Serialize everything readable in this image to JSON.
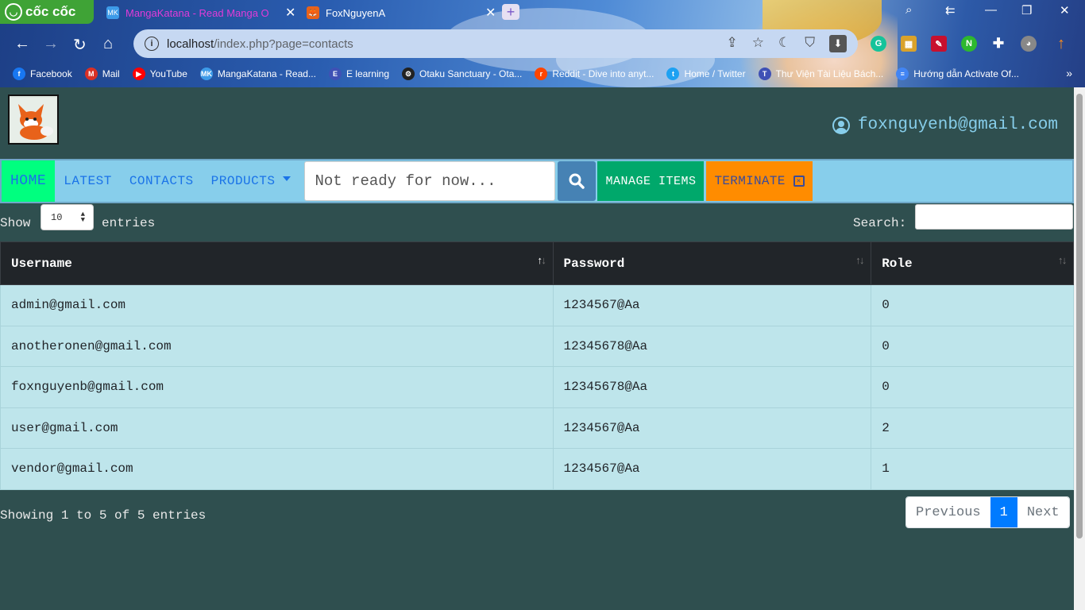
{
  "browser": {
    "brand": "cốc cốc",
    "tabs": [
      {
        "label": "MangaKatana - Read Manga O",
        "icon": "mangakatana-icon",
        "color": "#e23bd8"
      },
      {
        "label": "FoxNguyenA",
        "icon": "fox-icon",
        "color": "#ffffff"
      }
    ],
    "url_host": "localhost",
    "url_path": "/index.php?page=contacts",
    "bookmarks": [
      {
        "label": "Facebook",
        "icon": "facebook-icon",
        "color": "#1877f2",
        "glyph": "f"
      },
      {
        "label": "Mail",
        "icon": "gmail-icon",
        "color": "#d93025",
        "glyph": "M"
      },
      {
        "label": "YouTube",
        "icon": "youtube-icon",
        "color": "#ff0000",
        "glyph": "▶"
      },
      {
        "label": "MangaKatana - Read...",
        "icon": "mangakatana-icon",
        "color": "#3d9be9",
        "glyph": "MK"
      },
      {
        "label": "E learning",
        "icon": "elearning-icon",
        "color": "#3f51b5",
        "glyph": "E"
      },
      {
        "label": "Otaku Sanctuary - Ota...",
        "icon": "otaku-icon",
        "color": "#222222",
        "glyph": "⚙"
      },
      {
        "label": "Reddit - Dive into anyt...",
        "icon": "reddit-icon",
        "color": "#ff4500",
        "glyph": "r"
      },
      {
        "label": "Home / Twitter",
        "icon": "twitter-icon",
        "color": "#1da1f2",
        "glyph": "t"
      },
      {
        "label": "Thư Viện Tài Liệu Bách...",
        "icon": "library-icon",
        "color": "#3f51b5",
        "glyph": "T"
      },
      {
        "label": "Hướng dẫn Activate Of...",
        "icon": "document-icon",
        "color": "#4285f4",
        "glyph": "≡"
      }
    ]
  },
  "site": {
    "user_email": "foxnguyenb@gmail.com",
    "nav": {
      "home": "HOME",
      "latest": "LATEST",
      "contacts": "CONTACTS",
      "products": "PRODUCTS",
      "search_placeholder": "Not ready for now...",
      "manage": "MANAGE ITEMS",
      "terminate": "TERMINATE"
    },
    "colors": {
      "navbar": "#87ceeb",
      "home": "#00ff7f",
      "manage": "#00a86b",
      "terminate": "#ff8c00",
      "search_btn": "#4682b4"
    }
  },
  "datatable": {
    "show_label": "Show",
    "page_size": "10",
    "entries_label": "entries",
    "search_label": "Search:",
    "columns": [
      "Username",
      "Password",
      "Role"
    ],
    "rows": [
      [
        "admin@gmail.com",
        "1234567@Aa",
        "0"
      ],
      [
        "anotheronen@gmail.com",
        "12345678@Aa",
        "0"
      ],
      [
        "foxnguyenb@gmail.com",
        "12345678@Aa",
        "0"
      ],
      [
        "user@gmail.com",
        "1234567@Aa",
        "2"
      ],
      [
        "vendor@gmail.com",
        "1234567@Aa",
        "1"
      ]
    ],
    "info": "Showing 1 to 5 of 5 entries",
    "pager": {
      "previous": "Previous",
      "current": "1",
      "next": "Next"
    }
  }
}
